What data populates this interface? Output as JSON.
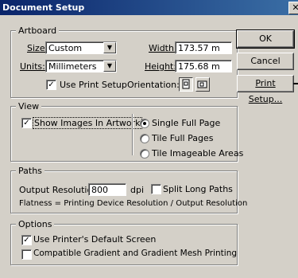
{
  "window": {
    "title": "Document Setup",
    "close_glyph": "✕"
  },
  "artboard": {
    "legend": "Artboard",
    "size_label": "Size:",
    "size_value": "Custom",
    "units_label": "Units:",
    "units_value": "Millimeters",
    "width_label": "Width:",
    "width_value": "173.57 m",
    "height_label": "Height:",
    "height_value": "175.68 m",
    "use_print_setup_label": "Use Print Setup",
    "use_print_setup_checked": true,
    "orientation_label": "Orientation:"
  },
  "view": {
    "legend": "View",
    "show_images_label": "Show Images In Artwork",
    "show_images_checked": true,
    "radios": [
      {
        "label": "Single Full Page",
        "selected": true
      },
      {
        "label": "Tile Full Pages",
        "selected": false
      },
      {
        "label": "Tile Imageable Areas",
        "selected": false
      }
    ]
  },
  "paths": {
    "legend": "Paths",
    "output_resolution_label": "Output Resolution:",
    "output_resolution_value": "800",
    "dpi_label": "dpi",
    "split_long_paths_label": "Split Long Paths",
    "split_long_paths_checked": false,
    "flatness_text": "Flatness = Printing Device Resolution / Output Resolution"
  },
  "options": {
    "legend": "Options",
    "default_screen_label": "Use Printer's Default Screen",
    "default_screen_checked": true,
    "compatible_gradient_label": "Compatible Gradient and Gradient Mesh Printing",
    "compatible_gradient_checked": false
  },
  "buttons": {
    "ok": "OK",
    "cancel": "Cancel",
    "print_setup": "Print Setup..."
  }
}
